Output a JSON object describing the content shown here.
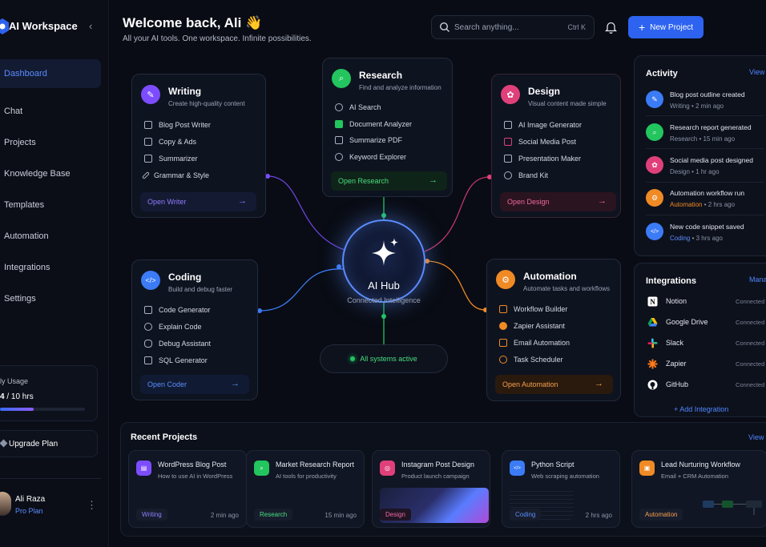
{
  "app": {
    "title": "AI Workspace"
  },
  "sidebar": {
    "items": [
      {
        "label": "Dashboard",
        "active": true
      },
      {
        "label": "Chat"
      },
      {
        "label": "Projects"
      },
      {
        "label": "Knowledge Base"
      },
      {
        "label": "Templates"
      },
      {
        "label": "Automation"
      },
      {
        "label": "Integrations"
      },
      {
        "label": "Settings"
      }
    ],
    "usage": {
      "label": "ly Usage",
      "used": "4",
      "total": " / 10 hrs",
      "fraction": 0.4
    },
    "upgrade_label": "Upgrade Plan",
    "user": {
      "name": "Ali Raza",
      "plan": "Pro Plan"
    }
  },
  "header": {
    "welcome": "Welcome back, Ali 👋",
    "subtitle": "All your AI tools. One workspace. Infinite possibilities.",
    "search_placeholder": "Search anything...",
    "search_shortcut": "Ctrl K",
    "new_project_label": "New Project"
  },
  "tools": {
    "writing": {
      "title": "Writing",
      "subtitle": "Create high-quality content",
      "items": [
        "Blog Post Writer",
        "Copy & Ads",
        "Summarizer",
        "Grammar & Style"
      ],
      "open": "Open Writer",
      "color": "#7c4dff"
    },
    "research": {
      "title": "Research",
      "subtitle": "Find and analyze information",
      "items": [
        "AI Search",
        "Document Analyzer",
        "Summarize PDF",
        "Keyword Explorer"
      ],
      "open": "Open Research",
      "color": "#22c55e"
    },
    "design": {
      "title": "Design",
      "subtitle": "Visual content made simple",
      "items": [
        "AI Image Generator",
        "Social Media Post",
        "Presentation Maker",
        "Brand Kit"
      ],
      "open": "Open Design",
      "color": "#e0407a"
    },
    "coding": {
      "title": "Coding",
      "subtitle": "Build and debug faster",
      "items": [
        "Code Generator",
        "Explain Code",
        "Debug Assistant",
        "SQL Generator"
      ],
      "open": "Open Coder",
      "color": "#3b7bf5"
    },
    "automation": {
      "title": "Automation",
      "subtitle": "Automate tasks and workflows",
      "items": [
        "Workflow Builder",
        "Zapier Assistant",
        "Email Automation",
        "Task Scheduler"
      ],
      "open": "Open Automation",
      "color": "#f08a24"
    }
  },
  "hub": {
    "title": "AI Hub",
    "subtitle": "Connected Intelligence",
    "status": "All systems active"
  },
  "activity": {
    "title": "Activity",
    "view_all": "View",
    "items": [
      {
        "title": "Blog post outline created",
        "category": "Writing",
        "time": "2 min ago",
        "color": "#3b7bf5",
        "icon": "pen-icon"
      },
      {
        "title": "Research report generated",
        "category": "Research",
        "time": "15 min ago",
        "color": "#22c55e",
        "icon": "search-icon"
      },
      {
        "title": "Social media post designed",
        "category": "Design",
        "time": "1 hr ago",
        "color": "#e0407a",
        "icon": "palette-icon"
      },
      {
        "title": "Automation workflow run",
        "category": "Automation",
        "time": "2 hrs ago",
        "color": "#f08a24",
        "icon": "gear-icon"
      },
      {
        "title": "New code snippet saved",
        "category": "Coding",
        "time": "3 hrs ago",
        "color": "#3b7bf5",
        "icon": "code-icon"
      }
    ]
  },
  "integrations": {
    "title": "Integrations",
    "manage": "Mana",
    "items": [
      {
        "name": "Notion",
        "status": "Connected"
      },
      {
        "name": "Google Drive",
        "status": "Connected"
      },
      {
        "name": "Slack",
        "status": "Connected"
      },
      {
        "name": "Zapier",
        "status": "Connected"
      },
      {
        "name": "GitHub",
        "status": "Connected"
      }
    ],
    "add_label": "+ Add Integration"
  },
  "recent": {
    "title": "Recent Projects",
    "view_all": "View",
    "items": [
      {
        "title": "WordPress Blog Post",
        "subtitle": "How to use AI in WordPress",
        "tag": "Writing",
        "time": "2 min ago",
        "color": "#7c4dff"
      },
      {
        "title": "Market Research Report",
        "subtitle": "AI tools for productivity",
        "tag": "Research",
        "time": "15 min ago",
        "color": "#22c55e"
      },
      {
        "title": "Instagram Post Design",
        "subtitle": "Product launch campaign",
        "tag": "Design",
        "time": "",
        "color": "#e0407a"
      },
      {
        "title": "Python Script",
        "subtitle": "Web scraping automation",
        "tag": "Coding",
        "time": "2 hrs ago",
        "color": "#3b7bf5"
      },
      {
        "title": "Lead Nurturing Workflow",
        "subtitle": "Email + CRM Automation",
        "tag": "Automation",
        "time": "",
        "color": "#f08a24"
      }
    ]
  }
}
